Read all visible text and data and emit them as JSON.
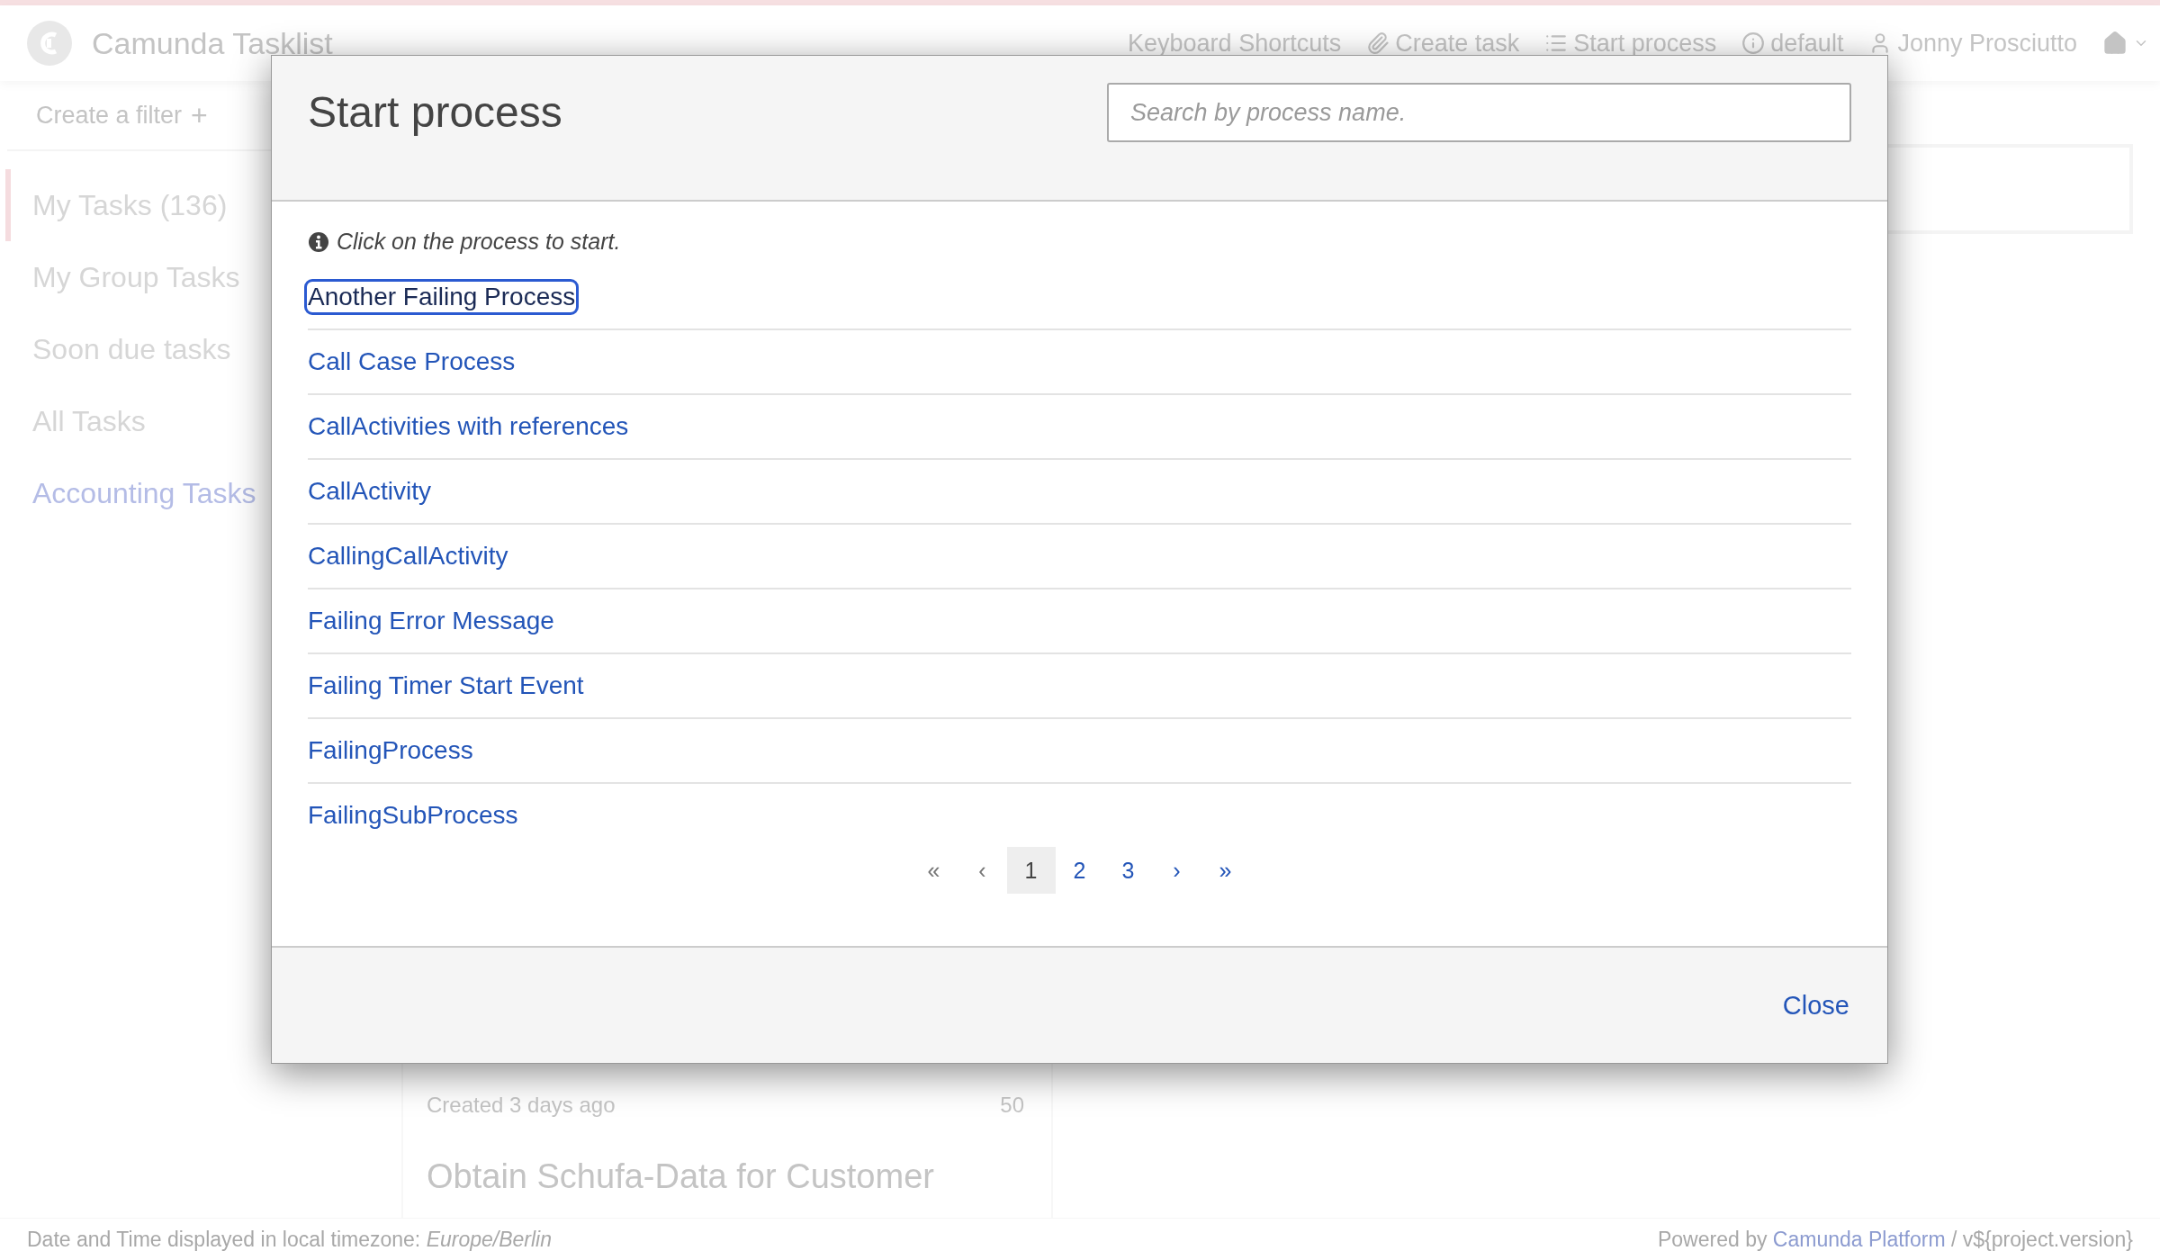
{
  "header": {
    "title": "Camunda Tasklist",
    "nav": [
      {
        "label": "Keyboard Shortcuts",
        "kind": "plain"
      },
      {
        "label": "Create task",
        "kind": "create"
      },
      {
        "label": "Start process",
        "kind": "start"
      },
      {
        "label": "default",
        "kind": "engine"
      },
      {
        "label": "Jonny Prosciutto",
        "kind": "account"
      }
    ]
  },
  "sidebar": {
    "create_filter": {
      "label": "Create a filter",
      "plus": "+"
    },
    "filters": [
      {
        "label": "My Tasks (136)",
        "selected": true,
        "color": "#d6d6d6"
      },
      {
        "label": "My Group Tasks",
        "selected": false,
        "color": "#d6d6d6"
      },
      {
        "label": "Soon due tasks",
        "selected": false,
        "color": "#d6d6d6"
      },
      {
        "label": "All Tasks",
        "selected": false,
        "color": "#d6d6d6"
      },
      {
        "label": "Accounting Tasks",
        "selected": false,
        "color": "#b4bce6"
      }
    ]
  },
  "task_card": {
    "created": "Created 3 days ago",
    "priority": "50",
    "title": "Obtain Schufa-Data for Customer"
  },
  "footer": {
    "timezone": "Date and Time displayed in local timezone: *Europe/Berlin*",
    "powered_by": "Powered by",
    "platform_link": "Camunda Platform",
    "version": "/ v${project.version}"
  },
  "modal": {
    "title": "Start process",
    "search": {
      "placeholder": "Search by process name."
    },
    "hint": "Click on the process to start.",
    "processes": [
      {
        "label": "Another Failing Process",
        "focused": true
      },
      {
        "label": "Call Case Process",
        "focused": false
      },
      {
        "label": "CallActivities with references",
        "focused": false
      },
      {
        "label": "CallActivity",
        "focused": false
      },
      {
        "label": "CallingCallActivity",
        "focused": false
      },
      {
        "label": "Failing Error Message",
        "focused": false
      },
      {
        "label": "Failing Timer Start Event",
        "focused": false
      },
      {
        "label": "FailingProcess",
        "focused": false
      },
      {
        "label": "FailingSubProcess",
        "focused": false
      }
    ],
    "pagination": [
      {
        "label": "«",
        "selected": false,
        "disabled": true
      },
      {
        "label": "‹",
        "selected": false,
        "disabled": true
      },
      {
        "label": "1",
        "selected": true,
        "disabled": false
      },
      {
        "label": "2",
        "selected": false,
        "disabled": false
      },
      {
        "label": "3",
        "selected": false,
        "disabled": false
      },
      {
        "label": "›",
        "selected": false,
        "disabled": false
      },
      {
        "label": "»",
        "selected": false,
        "disabled": false
      }
    ],
    "close": "Close"
  }
}
